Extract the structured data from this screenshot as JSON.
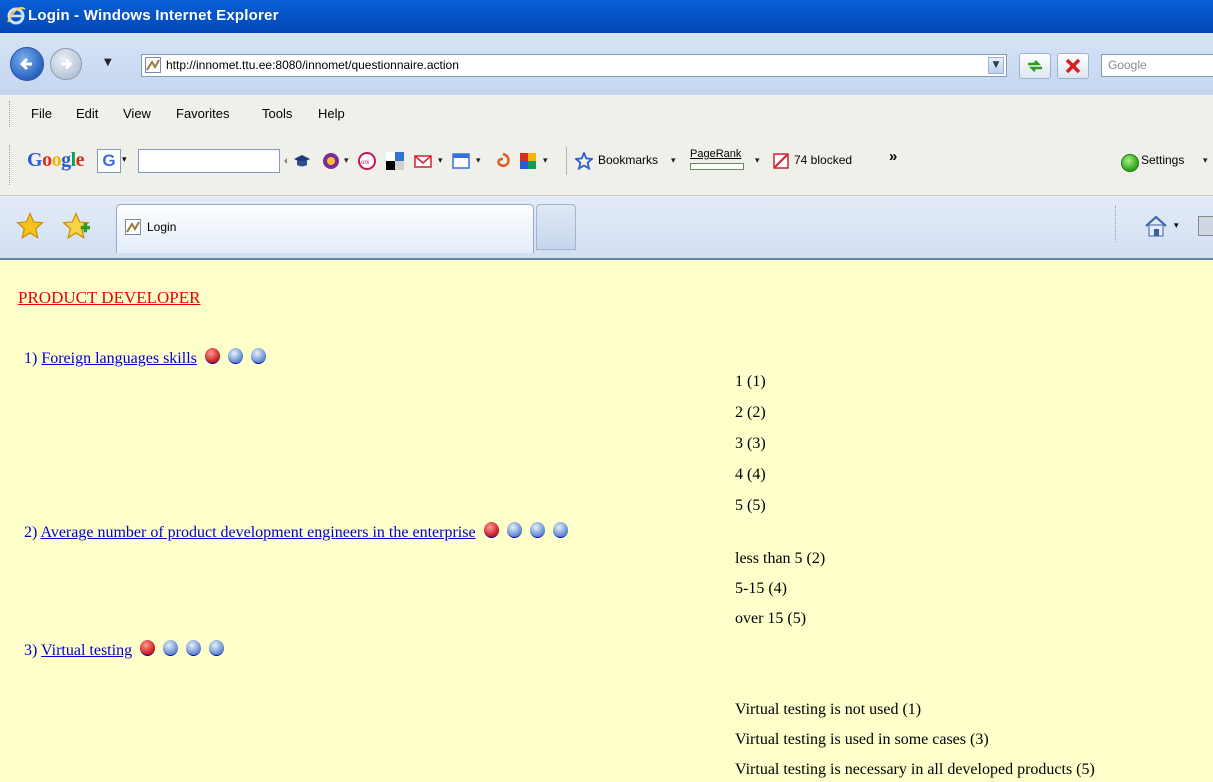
{
  "window": {
    "title": "Login - Windows Internet Explorer"
  },
  "address_bar": {
    "url": "http://innomet.ttu.ee:8080/innomet/questionnaire.action",
    "search_placeholder": "Google"
  },
  "menu": [
    "File",
    "Edit",
    "View",
    "Favorites",
    "Tools",
    "Help"
  ],
  "google_toolbar": {
    "logo": "Google",
    "g_button": "G",
    "bookmarks_label": "Bookmarks",
    "pagerank_label": "PageRank",
    "blocked_label": "74 blocked",
    "more_label": "»",
    "settings_label": "Settings"
  },
  "tabs": {
    "active_label": "Login"
  },
  "page": {
    "section_title": "PRODUCT DEVELOPER",
    "questions": [
      {
        "number": "1)",
        "title": "Foreign languages skills",
        "answers": [
          "1 (1)",
          "2 (2)",
          "3 (3)",
          "4 (4)",
          "5 (5)"
        ]
      },
      {
        "number": "2)",
        "title": "Average number of product development engineers in the enterprise",
        "answers": [
          "less than 5 (2)",
          "5-15 (4)",
          "over 15 (5)"
        ]
      },
      {
        "number": "3)",
        "title": "Virtual testing",
        "answers": [
          "Virtual testing is not used (1)",
          "Virtual testing is used in some cases (3)",
          "Virtual testing is necessary in all developed products (5)"
        ]
      }
    ]
  },
  "colors": {
    "section_title": "#e00000",
    "link": "#0000cc",
    "page_bg": "#ffffcc",
    "title_bar": "#0553c6"
  }
}
